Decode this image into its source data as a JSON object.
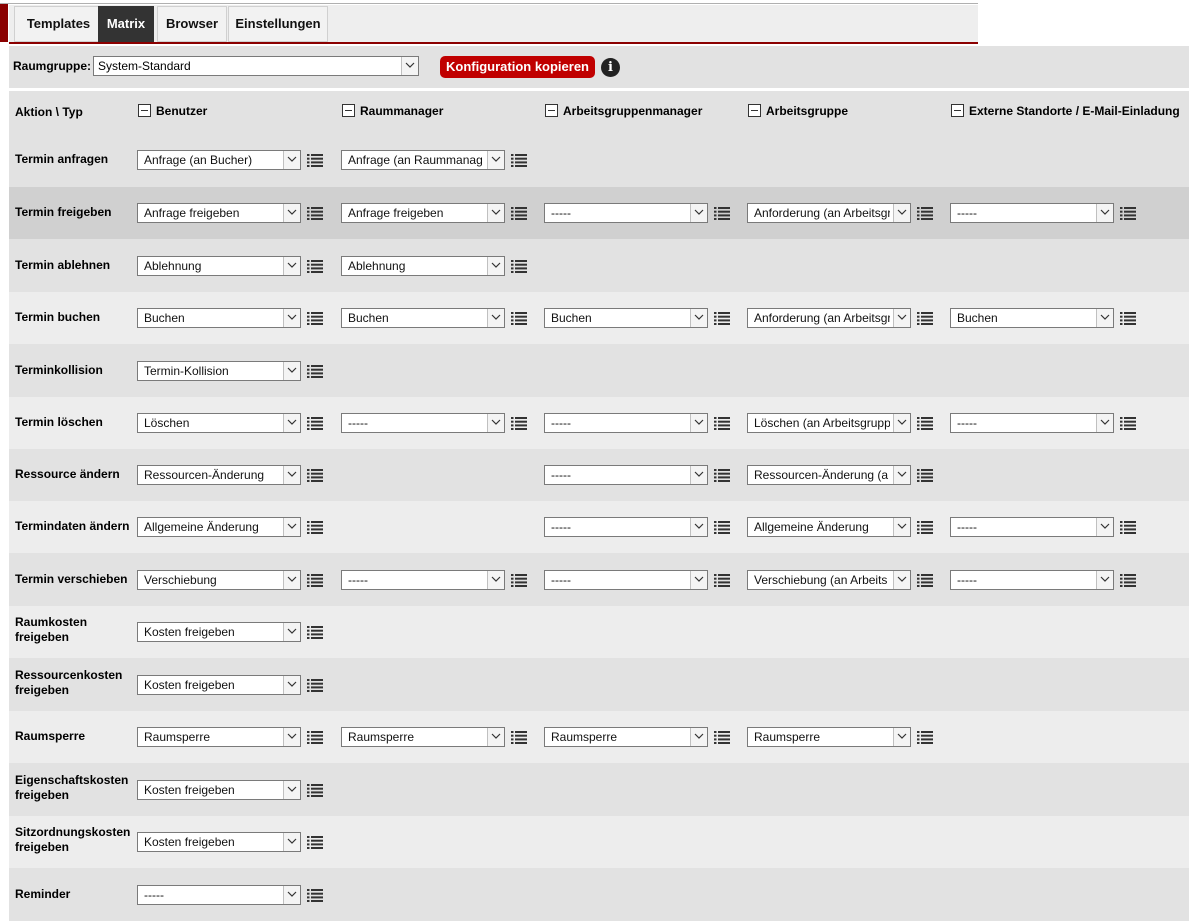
{
  "tabs": [
    "Templates",
    "Matrix",
    "Browser",
    "Einstellungen"
  ],
  "toolbar": {
    "raumgruppe_label": "Raumgruppe:",
    "raumgruppe_value": "System-Standard",
    "copy_button": "Konfiguration kopieren"
  },
  "matrix": {
    "corner_label": "Aktion \\ Typ",
    "columns": [
      "Benutzer",
      "Raummanager",
      "Arbeitsgruppenmanager",
      "Arbeitsgruppe",
      "Externe Standorte / E-Mail-Einladung"
    ],
    "rows": [
      {
        "label": "Termin anfragen",
        "cells": [
          "Anfrage (an Bucher)",
          "Anfrage (an Raummanag",
          null,
          null,
          null
        ]
      },
      {
        "label": "Termin freigeben",
        "cells": [
          "Anfrage freigeben",
          "Anfrage freigeben",
          "-----",
          "Anforderung (an Arbeitsgr",
          "-----"
        ]
      },
      {
        "label": "Termin ablehnen",
        "cells": [
          "Ablehnung",
          "Ablehnung",
          null,
          null,
          null
        ]
      },
      {
        "label": "Termin buchen",
        "cells": [
          "Buchen",
          "Buchen",
          "Buchen",
          "Anforderung (an Arbeitsgr",
          "Buchen"
        ]
      },
      {
        "label": "Terminkollision",
        "cells": [
          "Termin-Kollision",
          null,
          null,
          null,
          null
        ]
      },
      {
        "label": "Termin löschen",
        "cells": [
          "Löschen",
          "-----",
          "-----",
          "Löschen (an Arbeitsgrupp",
          "-----"
        ]
      },
      {
        "label": "Ressource ändern",
        "cells": [
          "Ressourcen-Änderung",
          null,
          "-----",
          "Ressourcen-Änderung (a",
          null
        ]
      },
      {
        "label": "Termindaten ändern",
        "cells": [
          "Allgemeine Änderung",
          null,
          "-----",
          "Allgemeine Änderung",
          "-----"
        ]
      },
      {
        "label": "Termin verschieben",
        "cells": [
          "Verschiebung",
          "-----",
          "-----",
          "Verschiebung (an Arbeits",
          "-----"
        ]
      },
      {
        "label": "Raumkosten freigeben",
        "cells": [
          "Kosten freigeben",
          null,
          null,
          null,
          null
        ]
      },
      {
        "label": "Ressourcenkosten freigeben",
        "cells": [
          "Kosten freigeben",
          null,
          null,
          null,
          null
        ]
      },
      {
        "label": "Raumsperre",
        "cells": [
          "Raumsperre",
          "Raumsperre",
          "Raumsperre",
          "Raumsperre",
          null
        ]
      },
      {
        "label": "Eigenschaftskosten freigeben",
        "cells": [
          "Kosten freigeben",
          null,
          null,
          null,
          null
        ]
      },
      {
        "label": "Sitzordnungskosten freigeben",
        "cells": [
          "Kosten freigeben",
          null,
          null,
          null,
          null
        ]
      },
      {
        "label": "Reminder",
        "cells": [
          "-----",
          null,
          null,
          null,
          null
        ]
      }
    ]
  },
  "icons": {
    "info": "info-icon",
    "dropdown_arrow": "chevron-down-icon",
    "details": "list-icon",
    "collapse": "minus-box-icon"
  },
  "colors": {
    "accent": "#8b0000",
    "copy_button": "#c00000",
    "active_tab": "#333333"
  }
}
